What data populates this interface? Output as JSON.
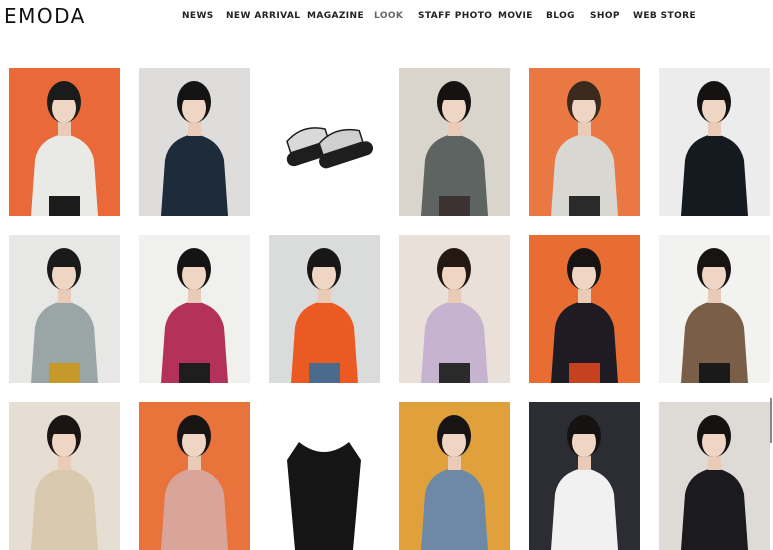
{
  "header": {
    "logo": "EMODA",
    "nav": [
      {
        "label": "NEWS"
      },
      {
        "label": "NEW ARRIVAL"
      },
      {
        "label": "MAGAZINE"
      },
      {
        "label": "LOOK"
      },
      {
        "label": "STAFF PHOTO"
      },
      {
        "label": "MOVIE"
      },
      {
        "label": "BLOG"
      },
      {
        "label": "SHOP"
      },
      {
        "label": "WEB STORE"
      }
    ]
  },
  "grid": {
    "rows": [
      {
        "tiles": [
          {
            "bg": "#e96a38",
            "top": "#e9e9e6",
            "bottom": "#1c1c1c",
            "hair": "#1b1b1b",
            "kind": "person"
          },
          {
            "bg": "#dedddb",
            "top": "#1d2b3b",
            "bottom": "#1d2b3b",
            "hair": "#141414",
            "kind": "person"
          },
          {
            "bg": "#ffffff",
            "top": "#1e1e1e",
            "bottom": "#1e1e1e",
            "hair": "#1e1e1e",
            "kind": "sandals"
          },
          {
            "bg": "#d9d4cc",
            "top": "#5d6462",
            "bottom": "#3d3232",
            "hair": "#161212",
            "kind": "person"
          },
          {
            "bg": "#e97842",
            "top": "#d8d7d2",
            "bottom": "#2a2a2a",
            "hair": "#3b2a1d",
            "kind": "person"
          },
          {
            "bg": "#ececec",
            "top": "#151a21",
            "bottom": "#151a21",
            "hair": "#151212",
            "kind": "person"
          }
        ]
      },
      {
        "tiles": [
          {
            "bg": "#e7e7e5",
            "top": "#9aa6a5",
            "bottom": "#c59a2a",
            "hair": "#1a1a1a",
            "kind": "person"
          },
          {
            "bg": "#f0f0ee",
            "top": "#b3315a",
            "bottom": "#1e1e1e",
            "hair": "#141414",
            "kind": "person"
          },
          {
            "bg": "#dadbdb",
            "top": "#ec5a24",
            "bottom": "#4a6b8c",
            "hair": "#171717",
            "kind": "person"
          },
          {
            "bg": "#e9e1d9",
            "top": "#c5b3cf",
            "bottom": "#2a2a2a",
            "hair": "#241812",
            "kind": "person"
          },
          {
            "bg": "#e86d32",
            "top": "#1e1b22",
            "bottom": "#c6411f",
            "hair": "#181414",
            "kind": "person"
          },
          {
            "bg": "#f2f2f0",
            "top": "#7a5e47",
            "bottom": "#1a1a1a",
            "hair": "#181414",
            "kind": "person"
          }
        ]
      },
      {
        "tiles": [
          {
            "bg": "#e6ded2",
            "top": "#d9c9ae",
            "bottom": "#d9c9ae",
            "hair": "#1a1512",
            "kind": "person"
          },
          {
            "bg": "#e8743c",
            "top": "#d9a59b",
            "bottom": "#d9a59b",
            "hair": "#181414",
            "kind": "person"
          },
          {
            "bg": "#ffffff",
            "top": "#151515",
            "bottom": "#151515",
            "hair": "#151515",
            "kind": "garment"
          },
          {
            "bg": "#e0a13c",
            "top": "#6e89a6",
            "bottom": "#6e89a6",
            "hair": "#181414",
            "kind": "person"
          },
          {
            "bg": "#2c2d33",
            "top": "#f1f1f1",
            "bottom": "#f1f1f1",
            "hair": "#151212",
            "kind": "person"
          },
          {
            "bg": "#dedbd6",
            "top": "#1b1b1f",
            "bottom": "#1b1b1f",
            "hair": "#151212",
            "kind": "person"
          }
        ]
      }
    ]
  }
}
